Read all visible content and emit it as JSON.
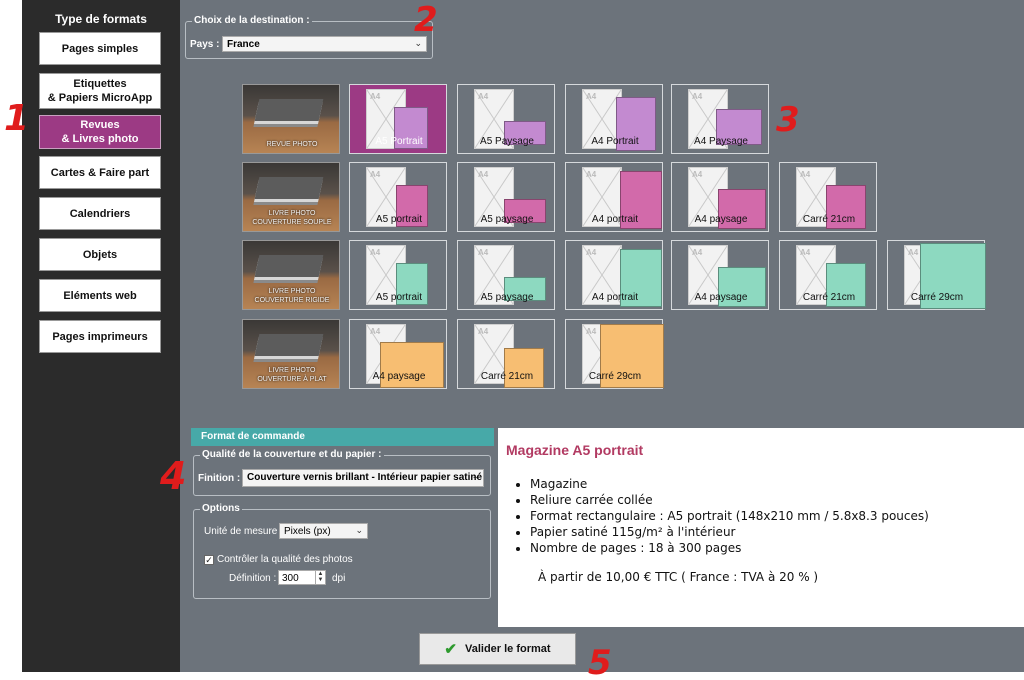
{
  "sidebar": {
    "title": "Type de formats",
    "items": [
      {
        "label": "Pages simples"
      },
      {
        "label": "Etiquettes\n& Papiers MicroApp"
      },
      {
        "label": "Revues\n& Livres photo",
        "active": true
      },
      {
        "label": "Cartes & Faire part"
      },
      {
        "label": "Calendriers"
      },
      {
        "label": "Objets"
      },
      {
        "label": "Eléments web"
      },
      {
        "label": "Pages imprimeurs"
      }
    ]
  },
  "destination": {
    "legend": "Choix de la destination :",
    "country_label": "Pays :",
    "country_value": "France"
  },
  "format_rows": [
    {
      "photo_caption": "REVUE PHOTO",
      "product_color": "#c38ad0",
      "items": [
        {
          "label": "A5 Portrait",
          "selected": true
        },
        {
          "label": "A5 Paysage"
        },
        {
          "label": "A4 Portrait"
        },
        {
          "label": "A4 Paysage"
        }
      ]
    },
    {
      "photo_caption": "LIVRE PHOTO\nCOUVERTURE SOUPLE",
      "product_color": "#d26aaa",
      "items": [
        {
          "label": "A5 portrait"
        },
        {
          "label": "A5 paysage"
        },
        {
          "label": "A4 portrait"
        },
        {
          "label": "A4 paysage"
        },
        {
          "label": "Carré 21cm"
        }
      ]
    },
    {
      "photo_caption": "LIVRE PHOTO\nCOUVERTURE RIGIDE",
      "product_color": "#8dd9c0",
      "items": [
        {
          "label": "A5 portrait"
        },
        {
          "label": "A5 paysage"
        },
        {
          "label": "A4 portrait"
        },
        {
          "label": "A4 paysage"
        },
        {
          "label": "Carré 21cm"
        },
        {
          "label": "Carré 29cm"
        }
      ]
    },
    {
      "photo_caption": "LIVRE PHOTO\nOUVERTURE À PLAT",
      "product_color": "#f7be72",
      "items": [
        {
          "label": "A4 paysage"
        },
        {
          "label": "Carré 21cm"
        },
        {
          "label": "Carré 29cm"
        }
      ]
    }
  ],
  "sheet_tag": "A4",
  "order": {
    "header": "Format de commande",
    "quality_legend": "Qualité de la couverture et du papier :",
    "finish_label": "Finition :",
    "finish_value": "Couverture vernis brillant - Intérieur papier satiné",
    "options_legend": "Options",
    "unit_label": "Unité de mesure :",
    "unit_value": "Pixels (px)",
    "check_quality_label": "Contrôler la qualité des photos",
    "check_quality_checked": true,
    "definition_label": "Définition :",
    "definition_value": "300",
    "definition_unit": "dpi"
  },
  "description": {
    "title": "Magazine A5 portrait",
    "bullets": [
      "Magazine",
      "Reliure carrée collée",
      "Format rectangulaire : A5 portrait (148x210 mm / 5.8x8.3 pouces)",
      "Papier satiné 115g/m² à l'intérieur",
      "Nombre de pages : 18 à 300 pages"
    ],
    "price": "À partir de 10,00 € TTC ( France : TVA à 20 % )"
  },
  "validate_label": "Valider le format",
  "annotations": [
    "1",
    "2",
    "3",
    "4",
    "5"
  ]
}
